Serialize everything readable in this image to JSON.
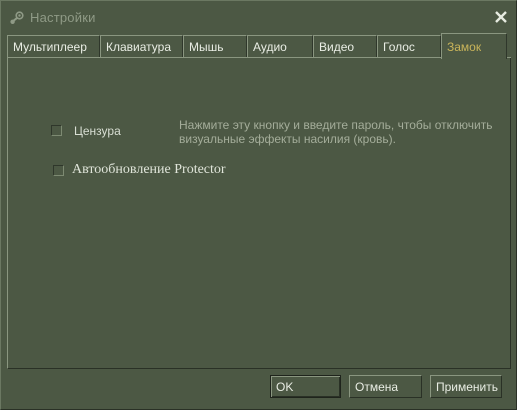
{
  "window": {
    "title": "Настройки",
    "title_icon": "steam-icon",
    "close_icon": "close-icon"
  },
  "tabs": [
    {
      "label": "Мультиплеер",
      "active": false
    },
    {
      "label": "Клавиатура",
      "active": false
    },
    {
      "label": "Мышь",
      "active": false
    },
    {
      "label": "Аудио",
      "active": false
    },
    {
      "label": "Видео",
      "active": false
    },
    {
      "label": "Голос",
      "active": false
    },
    {
      "label": "Замок",
      "active": true
    }
  ],
  "lock_panel": {
    "censor_checkbox": {
      "label": "Цензура",
      "checked": false
    },
    "hint_text": "Нажмите эту кнопку и введите пароль, чтобы отключить визуальные эффекты насилия (кровь).",
    "protector_checkbox": {
      "label": "Автообновление Protector",
      "checked": false
    }
  },
  "buttons": {
    "ok": "OK",
    "cancel": "Отмена",
    "apply": "Применить"
  },
  "colors": {
    "background": "#4c5844",
    "active_tab_text": "#c9b45a",
    "text": "#d8ded3",
    "hint_text": "#a4ad9a"
  }
}
